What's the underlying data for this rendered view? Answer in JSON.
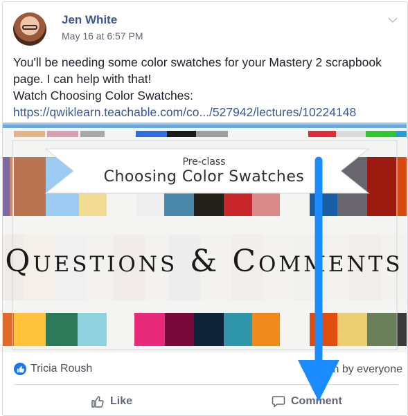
{
  "post": {
    "author": "Jen White",
    "timestamp": "May 16 at 6:57 PM",
    "text_line1": "You'll be needing some color swatches for your Mastery 2 scrapbook page. I can help with that!",
    "text_line2": "Watch Choosing Color Swatches:",
    "link": "https://qwiklearn.teachable.com/co.../527942/lectures/10224148"
  },
  "media": {
    "pre_class": "Pre-class",
    "banner_title": "Choosing Color Swatches",
    "big_title": "Questions & Comments"
  },
  "reactions": {
    "reactor": "Tricia Roush",
    "seen_by": "n by everyone"
  },
  "actions": {
    "like_label": "Like",
    "comment_label": "Comment"
  },
  "colors": {
    "brand_blue": "#385898",
    "annotation_arrow": "#1a8cff"
  },
  "icons": {
    "options": "chevron-down-icon",
    "reaction": "like-icon",
    "like": "thumbs-up-icon",
    "comment": "comment-icon"
  }
}
